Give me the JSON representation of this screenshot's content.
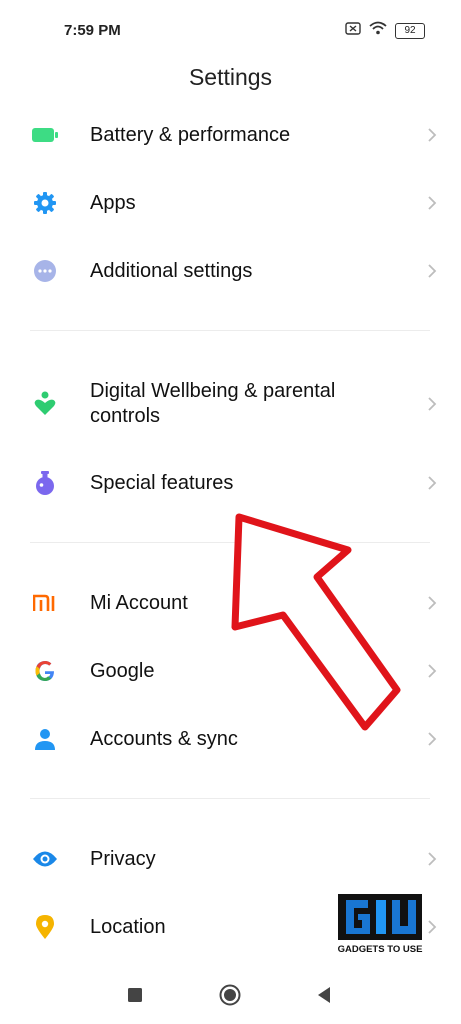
{
  "status_bar": {
    "time": "7:59 PM",
    "battery": "92"
  },
  "header": {
    "title": "Settings"
  },
  "groups": [
    {
      "items": [
        {
          "label": "Battery & performance",
          "icon": "battery-icon"
        },
        {
          "label": "Apps",
          "icon": "gear-icon"
        },
        {
          "label": "Additional settings",
          "icon": "more-dots-icon"
        }
      ]
    },
    {
      "items": [
        {
          "label": "Digital Wellbeing & parental controls",
          "label_line1": "Digital Wellbeing & parental",
          "label_line2": "controls",
          "icon": "wellbeing-icon"
        },
        {
          "label": "Special features",
          "icon": "flask-icon"
        }
      ]
    },
    {
      "items": [
        {
          "label": "Mi Account",
          "icon": "mi-logo-icon"
        },
        {
          "label": "Google",
          "icon": "google-icon"
        },
        {
          "label": "Accounts & sync",
          "icon": "person-icon"
        }
      ]
    },
    {
      "items": [
        {
          "label": "Privacy",
          "icon": "eye-icon"
        },
        {
          "label": "Location",
          "icon": "location-pin-icon"
        }
      ]
    }
  ],
  "watermark": {
    "text": "GADGETS TO USE",
    "logo": "GU"
  },
  "colors": {
    "battery": "#3ddc84",
    "apps": "#2196f3",
    "additional": "#a7b4e8",
    "wellbeing": "#2ecc71",
    "special": "#7b68ee",
    "mi": "#ff6900",
    "accounts": "#2196f3",
    "privacy": "#1a88e8",
    "location": "#f5b400",
    "chevron": "#bdbdbd",
    "arrow": "#e0141a"
  },
  "icons": [
    "battery-icon",
    "gear-icon",
    "more-dots-icon",
    "wellbeing-icon",
    "flask-icon",
    "mi-logo-icon",
    "google-icon",
    "person-icon",
    "eye-icon",
    "location-pin-icon",
    "chevron-right-icon",
    "recents-icon",
    "home-icon",
    "back-icon"
  ]
}
